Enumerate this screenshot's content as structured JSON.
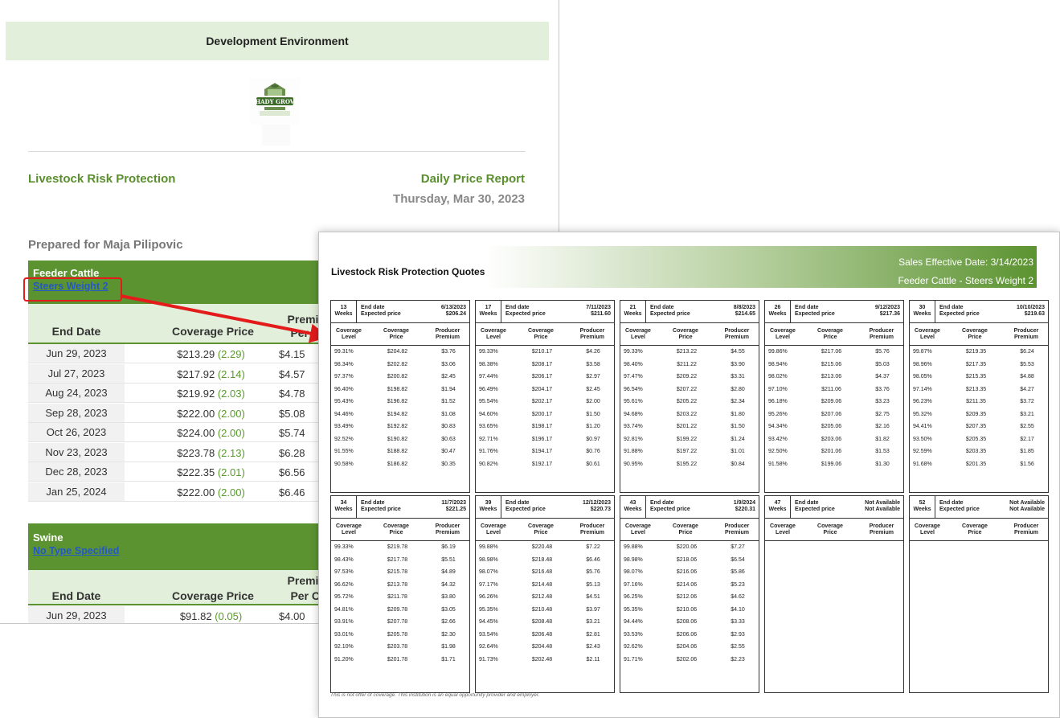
{
  "email": {
    "environment_label": "Development Environment",
    "report_title": "Livestock Risk Protection",
    "report_name": "Daily Price Report",
    "report_date": "Thursday, Mar 30, 2023",
    "prepared_for": "Prepared for Maja Pilipovic",
    "logo_text": "SHADY GROVE",
    "sections": [
      {
        "name": "Feeder Cattle",
        "type_link": "Steers Weight 2",
        "headers": {
          "end_date": "End Date",
          "coverage_price": "Coverage Price",
          "premium": "Premium",
          "premium_unit": "Per Cwt"
        },
        "rows": [
          {
            "end_date": "Jun 29, 2023",
            "price": "$213.29",
            "change": "(2.29)",
            "premium": "$4.15"
          },
          {
            "end_date": "Jul 27, 2023",
            "price": "$217.92",
            "change": "(2.14)",
            "premium": "$4.57"
          },
          {
            "end_date": "Aug 24, 2023",
            "price": "$219.92",
            "change": "(2.03)",
            "premium": "$4.78"
          },
          {
            "end_date": "Sep 28, 2023",
            "price": "$222.00",
            "change": "(2.00)",
            "premium": "$5.08"
          },
          {
            "end_date": "Oct 26, 2023",
            "price": "$224.00",
            "change": "(2.00)",
            "premium": "$5.74"
          },
          {
            "end_date": "Nov 23, 2023",
            "price": "$223.78",
            "change": "(2.13)",
            "premium": "$6.28"
          },
          {
            "end_date": "Dec 28, 2023",
            "price": "$222.35",
            "change": "(2.01)",
            "premium": "$6.56"
          },
          {
            "end_date": "Jan 25, 2024",
            "price": "$222.00",
            "change": "(2.00)",
            "premium": "$6.46"
          }
        ]
      },
      {
        "name": "Swine",
        "type_link": "No Type Specified",
        "headers": {
          "end_date": "End Date",
          "coverage_price": "Coverage Price",
          "premium": "Premium",
          "premium_unit": "Per Cwt"
        },
        "rows": [
          {
            "end_date": "Jun 29, 2023",
            "price": "$91.82",
            "change": "(0.05)",
            "premium": "$4.00"
          }
        ]
      }
    ]
  },
  "pdf": {
    "title": "Livestock Risk Protection Quotes",
    "sales_effective": "Sales Effective Date: 3/14/2023",
    "product": "Feeder Cattle - Steers Weight 2",
    "disclaimer": "This is not offer of coverage. This institution is an equal opportunity provider and employer.",
    "labels": {
      "weeks": "Weeks",
      "end_date": "End date",
      "expected_price": "Expected price",
      "coverage": "Coverage",
      "level": "Level",
      "price": "Price",
      "producer": "Producer",
      "premium": "Premium"
    },
    "quotes": [
      {
        "weeks": "13",
        "date": "6/13/2023",
        "price": "$206.24",
        "rows": [
          [
            "99.31%",
            "$204.82",
            "$3.76"
          ],
          [
            "98.34%",
            "$202.82",
            "$3.06"
          ],
          [
            "97.37%",
            "$200.82",
            "$2.45"
          ],
          [
            "96.40%",
            "$198.82",
            "$1.94"
          ],
          [
            "95.43%",
            "$196.82",
            "$1.52"
          ],
          [
            "94.46%",
            "$194.82",
            "$1.08"
          ],
          [
            "93.49%",
            "$192.82",
            "$0.83"
          ],
          [
            "92.52%",
            "$190.82",
            "$0.63"
          ],
          [
            "91.55%",
            "$188.82",
            "$0.47"
          ],
          [
            "90.58%",
            "$186.82",
            "$0.35"
          ]
        ]
      },
      {
        "weeks": "17",
        "date": "7/11/2023",
        "price": "$211.60",
        "rows": [
          [
            "99.33%",
            "$210.17",
            "$4.26"
          ],
          [
            "98.38%",
            "$208.17",
            "$3.58"
          ],
          [
            "97.44%",
            "$206.17",
            "$2.97"
          ],
          [
            "96.49%",
            "$204.17",
            "$2.45"
          ],
          [
            "95.54%",
            "$202.17",
            "$2.00"
          ],
          [
            "94.60%",
            "$200.17",
            "$1.50"
          ],
          [
            "93.65%",
            "$198.17",
            "$1.20"
          ],
          [
            "92.71%",
            "$196.17",
            "$0.97"
          ],
          [
            "91.76%",
            "$194.17",
            "$0.76"
          ],
          [
            "90.82%",
            "$192.17",
            "$0.61"
          ]
        ]
      },
      {
        "weeks": "21",
        "date": "8/8/2023",
        "price": "$214.65",
        "rows": [
          [
            "99.33%",
            "$213.22",
            "$4.55"
          ],
          [
            "98.40%",
            "$211.22",
            "$3.90"
          ],
          [
            "97.47%",
            "$209.22",
            "$3.31"
          ],
          [
            "96.54%",
            "$207.22",
            "$2.80"
          ],
          [
            "95.61%",
            "$205.22",
            "$2.34"
          ],
          [
            "94.68%",
            "$203.22",
            "$1.80"
          ],
          [
            "93.74%",
            "$201.22",
            "$1.50"
          ],
          [
            "92.81%",
            "$199.22",
            "$1.24"
          ],
          [
            "91.88%",
            "$197.22",
            "$1.01"
          ],
          [
            "90.95%",
            "$195.22",
            "$0.84"
          ]
        ]
      },
      {
        "weeks": "26",
        "date": "9/12/2023",
        "price": "$217.36",
        "rows": [
          [
            "99.86%",
            "$217.06",
            "$5.76"
          ],
          [
            "98.94%",
            "$215.06",
            "$5.03"
          ],
          [
            "98.02%",
            "$213.06",
            "$4.37"
          ],
          [
            "97.10%",
            "$211.06",
            "$3.76"
          ],
          [
            "96.18%",
            "$209.06",
            "$3.23"
          ],
          [
            "95.26%",
            "$207.06",
            "$2.75"
          ],
          [
            "94.34%",
            "$205.06",
            "$2.16"
          ],
          [
            "93.42%",
            "$203.06",
            "$1.82"
          ],
          [
            "92.50%",
            "$201.06",
            "$1.53"
          ],
          [
            "91.58%",
            "$199.06",
            "$1.30"
          ]
        ]
      },
      {
        "weeks": "30",
        "date": "10/10/2023",
        "price": "$219.63",
        "rows": [
          [
            "99.87%",
            "$219.35",
            "$6.24"
          ],
          [
            "98.96%",
            "$217.35",
            "$5.53"
          ],
          [
            "98.05%",
            "$215.35",
            "$4.88"
          ],
          [
            "97.14%",
            "$213.35",
            "$4.27"
          ],
          [
            "96.23%",
            "$211.35",
            "$3.72"
          ],
          [
            "95.32%",
            "$209.35",
            "$3.21"
          ],
          [
            "94.41%",
            "$207.35",
            "$2.55"
          ],
          [
            "93.50%",
            "$205.35",
            "$2.17"
          ],
          [
            "92.59%",
            "$203.35",
            "$1.85"
          ],
          [
            "91.68%",
            "$201.35",
            "$1.56"
          ]
        ]
      },
      {
        "weeks": "34",
        "date": "11/7/2023",
        "price": "$221.25",
        "rows": [
          [
            "99.33%",
            "$219.78",
            "$6.19"
          ],
          [
            "98.43%",
            "$217.78",
            "$5.51"
          ],
          [
            "97.53%",
            "$215.78",
            "$4.89"
          ],
          [
            "96.62%",
            "$213.78",
            "$4.32"
          ],
          [
            "95.72%",
            "$211.78",
            "$3.80"
          ],
          [
            "94.81%",
            "$209.78",
            "$3.05"
          ],
          [
            "93.91%",
            "$207.78",
            "$2.66"
          ],
          [
            "93.01%",
            "$205.78",
            "$2.30"
          ],
          [
            "92.10%",
            "$203.78",
            "$1.98"
          ],
          [
            "91.20%",
            "$201.78",
            "$1.71"
          ]
        ]
      },
      {
        "weeks": "39",
        "date": "12/12/2023",
        "price": "$220.73",
        "rows": [
          [
            "99.88%",
            "$220.48",
            "$7.22"
          ],
          [
            "98.98%",
            "$218.48",
            "$6.46"
          ],
          [
            "98.07%",
            "$216.48",
            "$5.76"
          ],
          [
            "97.17%",
            "$214.48",
            "$5.13"
          ],
          [
            "96.26%",
            "$212.48",
            "$4.51"
          ],
          [
            "95.35%",
            "$210.48",
            "$3.97"
          ],
          [
            "94.45%",
            "$208.48",
            "$3.21"
          ],
          [
            "93.54%",
            "$206.48",
            "$2.81"
          ],
          [
            "92.64%",
            "$204.48",
            "$2.43"
          ],
          [
            "91.73%",
            "$202.48",
            "$2.11"
          ]
        ]
      },
      {
        "weeks": "43",
        "date": "1/9/2024",
        "price": "$220.31",
        "rows": [
          [
            "99.88%",
            "$220.06",
            "$7.27"
          ],
          [
            "98.98%",
            "$218.06",
            "$6.54"
          ],
          [
            "98.07%",
            "$216.06",
            "$5.86"
          ],
          [
            "97.16%",
            "$214.06",
            "$5.23"
          ],
          [
            "96.25%",
            "$212.06",
            "$4.62"
          ],
          [
            "95.35%",
            "$210.06",
            "$4.10"
          ],
          [
            "94.44%",
            "$208.06",
            "$3.33"
          ],
          [
            "93.53%",
            "$206.06",
            "$2.93"
          ],
          [
            "92.62%",
            "$204.06",
            "$2.55"
          ],
          [
            "91.71%",
            "$202.06",
            "$2.23"
          ]
        ]
      },
      {
        "weeks": "47",
        "date": "Not Available",
        "price": "Not Available",
        "rows": []
      },
      {
        "weeks": "52",
        "date": "Not Available",
        "price": "Not Available",
        "rows": []
      }
    ]
  }
}
